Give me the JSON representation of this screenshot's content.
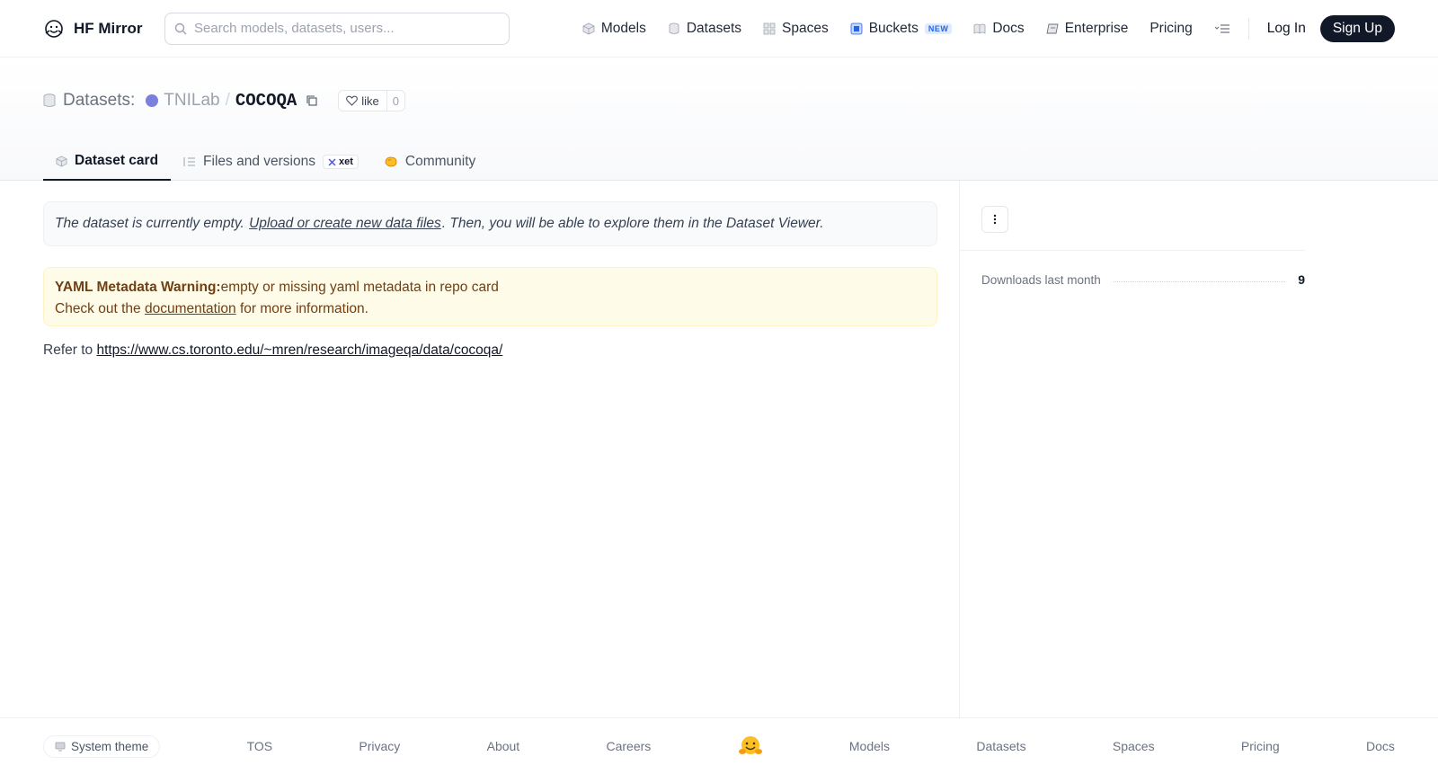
{
  "brand": {
    "name": "HF Mirror",
    "logo_icon": "hugging-face-logo"
  },
  "search": {
    "placeholder": "Search models, datasets, users..."
  },
  "nav": {
    "items": [
      {
        "label": "Models",
        "icon": "cube-icon"
      },
      {
        "label": "Datasets",
        "icon": "database-icon"
      },
      {
        "label": "Spaces",
        "icon": "grid-icon"
      },
      {
        "label": "Buckets",
        "icon": "bucket-icon",
        "badge": "NEW"
      },
      {
        "label": "Docs",
        "icon": "book-icon"
      },
      {
        "label": "Enterprise",
        "icon": "enterprise-icon"
      },
      {
        "label": "Pricing"
      }
    ],
    "login": "Log In",
    "signup": "Sign Up"
  },
  "repo": {
    "kind": "Datasets:",
    "owner": "TNILab",
    "separator": "/",
    "name": "COCOQA",
    "like_label": "like",
    "like_count": "0"
  },
  "tabs": [
    {
      "label": "Dataset card",
      "active": true
    },
    {
      "label": "Files and versions",
      "badge": "xet"
    },
    {
      "label": "Community"
    }
  ],
  "main": {
    "empty_note": {
      "before": "The dataset is currently empty.",
      "link": "Upload or create new data files",
      "after": ". Then, you will be able to explore them in the Dataset Viewer."
    },
    "warning": {
      "title": "YAML Metadata Warning:",
      "message": "empty or missing yaml metadata in repo card",
      "line2_before": "Check out the",
      "line2_link": "documentation",
      "line2_after": "for more information."
    },
    "refer": {
      "prefix": "Refer to",
      "link": "https://www.cs.toronto.edu/~mren/research/imageqa/data/cocoqa/"
    }
  },
  "sidebar": {
    "downloads_label": "Downloads last month",
    "downloads_value": "9"
  },
  "footer": {
    "theme": "System theme",
    "links": [
      "TOS",
      "Privacy",
      "About",
      "Careers",
      "Models",
      "Datasets",
      "Spaces",
      "Pricing",
      "Docs"
    ]
  },
  "colors": {
    "accent_dark": "#111827",
    "warning_bg": "#fefce8",
    "warning_text": "#713f12",
    "owner_avatar": "#7c7fdc",
    "new_badge": "#2563eb"
  }
}
